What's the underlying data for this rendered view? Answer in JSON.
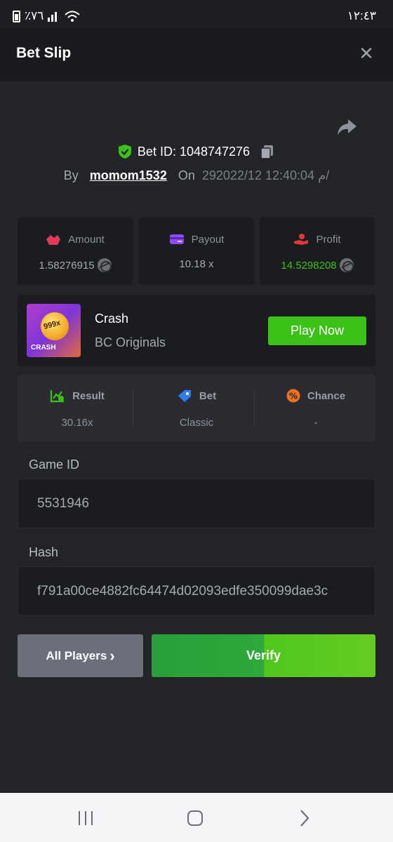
{
  "status": {
    "battery": "٪٧٦",
    "time": "١٢:٤٣"
  },
  "header": {
    "title": "Bet Slip",
    "close_symbol": "✕"
  },
  "bet": {
    "id_label": "Bet ID: 1048747276",
    "by_label": "By",
    "username": "momom1532",
    "on_label": "On",
    "datetime": "29م 12:40:04 2022/12/"
  },
  "stats": [
    {
      "label": "Amount",
      "value": "1.58276915",
      "icon": "amount-icon",
      "color": "#a5a8b0"
    },
    {
      "label": "Payout",
      "value": "10.18 x",
      "icon": "payout-card-icon",
      "color": "#a5a8b0"
    },
    {
      "label": "Profit",
      "value": "14.5298208",
      "icon": "profit-hand-icon",
      "color": "#3bc117"
    }
  ],
  "game": {
    "name": "Crash",
    "provider": "BC Originals",
    "thumb_multiplier": "999x",
    "thumb_tag": "CRASH",
    "play_label": "Play Now"
  },
  "info": [
    {
      "label": "Result",
      "value": "30.16x",
      "icon": "result-chart-icon",
      "color": "#3bc117"
    },
    {
      "label": "Bet",
      "value": "Classic",
      "icon": "bet-tag-icon",
      "color": "#2f7cf6"
    },
    {
      "label": "Chance",
      "value": "-",
      "icon": "chance-percent-icon",
      "color": "#f0701e"
    }
  ],
  "fields": {
    "game_id_label": "Game ID",
    "game_id_value": "5531946",
    "hash_label": "Hash",
    "hash_value": "f791a00ce4882fc64474d02093edfe350099dae3c"
  },
  "buttons": {
    "players_label": "All Players",
    "players_chevron": "›",
    "verify_label": "Verify"
  },
  "colors": {
    "accent_green": "#3bc117",
    "background": "#232428",
    "card": "#1b1c1f"
  }
}
